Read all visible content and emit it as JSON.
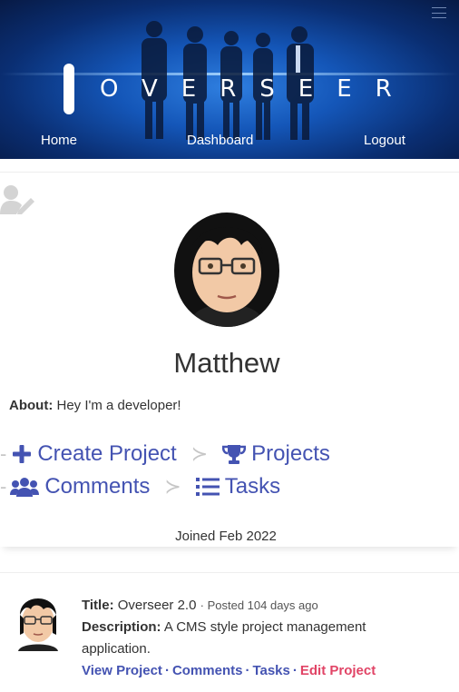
{
  "header": {
    "logo_text": "OVERSEER",
    "nav": [
      {
        "label": "Home"
      },
      {
        "label": "Dashboard"
      },
      {
        "label": "Logout"
      }
    ]
  },
  "profile": {
    "name": "Matthew",
    "about_label": "About:",
    "about_text": "Hey I'm a developer!",
    "actions": {
      "create_project": "Create Project",
      "projects": "Projects",
      "comments": "Comments",
      "tasks": "Tasks"
    },
    "separator": "≻",
    "joined": "Joined Feb 2022"
  },
  "project": {
    "title_label": "Title:",
    "title": "Overseer 2.0",
    "posted": "Posted 104 days ago",
    "description_label": "Description:",
    "description": "A CMS style project management application.",
    "links": {
      "view": "View Project",
      "comments": "Comments",
      "tasks": "Tasks",
      "edit": "Edit Project"
    },
    "link_separator": "·"
  },
  "colors": {
    "link": "#4453b2",
    "edit_link": "#e14466",
    "banner": "#1456b8"
  },
  "icons": {
    "edit_user": "user-edit-icon",
    "create": "plus-icon",
    "projects": "trophy-icon",
    "comments": "users-icon",
    "tasks": "list-icon",
    "menu": "hamburger-icon"
  }
}
